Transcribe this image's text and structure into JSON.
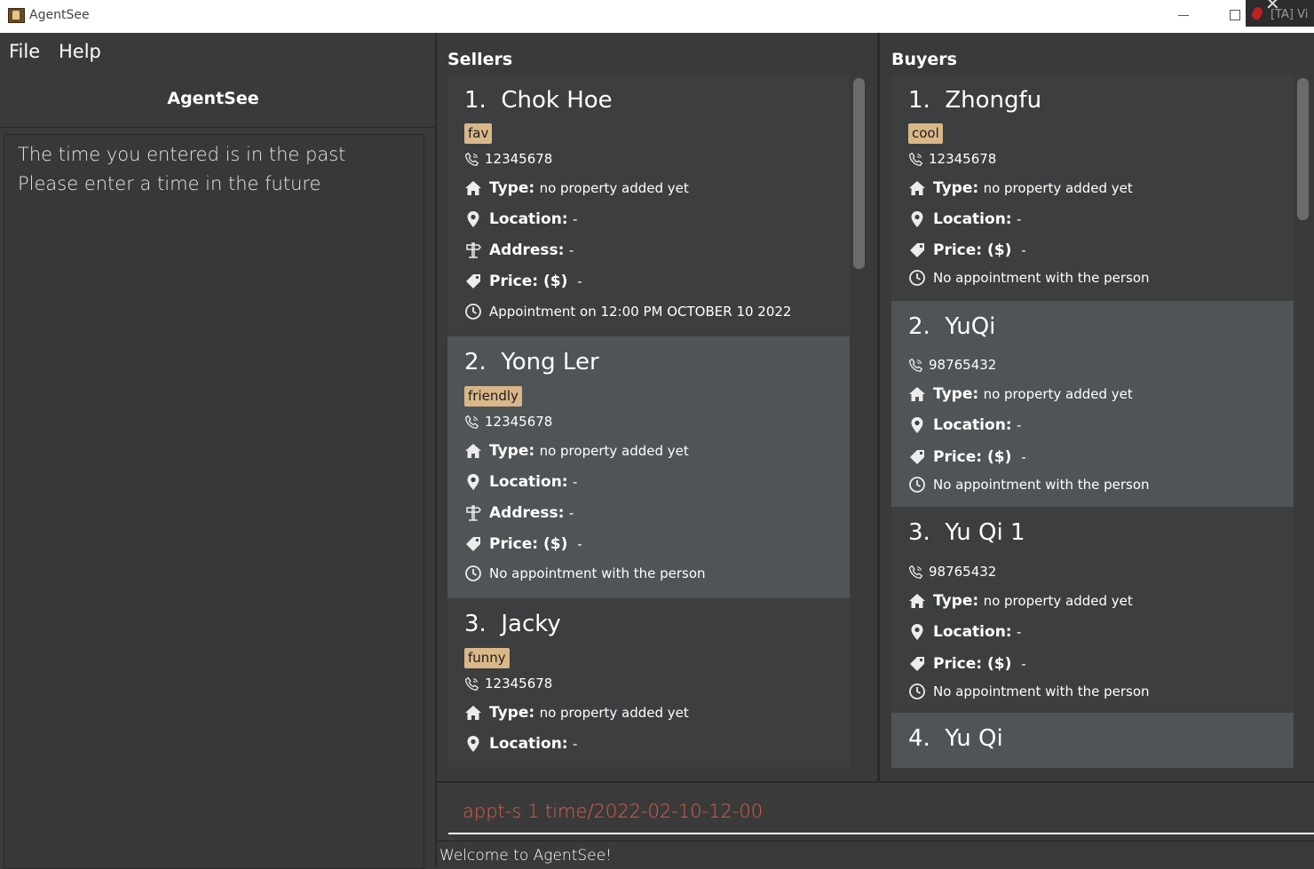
{
  "window": {
    "title": "AgentSee",
    "overlay_text": "[TA] Vi"
  },
  "menu": {
    "file": "File",
    "help": "Help"
  },
  "app_heading": "AgentSee",
  "result": {
    "line1": "The time you entered is in the past",
    "line2": "Please enter a time in the future"
  },
  "sellers": {
    "title": "Sellers",
    "cards": [
      {
        "index": "1.",
        "name": "Chok Hoe",
        "tag": "fav",
        "phone": "12345678",
        "type_label": "Type:",
        "type_value": "no property added yet",
        "location_label": "Location:",
        "location_value": "-",
        "address_label": "Address:",
        "address_value": "-",
        "price_label": "Price: ($)",
        "price_value": "-",
        "appointment": "Appointment on 12:00 PM OCTOBER 10 2022"
      },
      {
        "index": "2.",
        "name": "Yong Ler",
        "tag": "friendly",
        "phone": "12345678",
        "type_label": "Type:",
        "type_value": "no property added yet",
        "location_label": "Location:",
        "location_value": "-",
        "address_label": "Address:",
        "address_value": "-",
        "price_label": "Price: ($)",
        "price_value": "-",
        "appointment": "No appointment with the person"
      },
      {
        "index": "3.",
        "name": "Jacky",
        "tag": "funny",
        "phone": "12345678",
        "type_label": "Type:",
        "type_value": "no property added yet",
        "location_label": "Location:",
        "location_value": "-"
      }
    ]
  },
  "buyers": {
    "title": "Buyers",
    "cards": [
      {
        "index": "1.",
        "name": "Zhongfu",
        "tag": "cool",
        "phone": "12345678",
        "type_label": "Type:",
        "type_value": "no property added yet",
        "location_label": "Location:",
        "location_value": "-",
        "price_label": "Price: ($)",
        "price_value": "-",
        "appointment": "No appointment with the person"
      },
      {
        "index": "2.",
        "name": "YuQi",
        "phone": "98765432",
        "type_label": "Type:",
        "type_value": "no property added yet",
        "location_label": "Location:",
        "location_value": "-",
        "price_label": "Price: ($)",
        "price_value": "-",
        "appointment": "No appointment with the person"
      },
      {
        "index": "3.",
        "name": "Yu Qi 1",
        "phone": "98765432",
        "type_label": "Type:",
        "type_value": "no property added yet",
        "location_label": "Location:",
        "location_value": "-",
        "price_label": "Price: ($)",
        "price_value": "-",
        "appointment": "No appointment with the person"
      },
      {
        "index": "4.",
        "name": "Yu Qi"
      }
    ]
  },
  "command": {
    "value": "appt-s 1 time/2022-02-10-12-00"
  },
  "status": {
    "text": "Welcome to AgentSee!"
  },
  "colors": {
    "background": "#3a3a3a",
    "card": "#3c3e3f",
    "card_alt": "#4f5457",
    "tag": "#d9b789",
    "command_text": "#d75f4b"
  },
  "icons": {
    "phone": "phone-icon",
    "type": "house-icon",
    "location": "location-pin-icon",
    "address": "signpost-icon",
    "price": "price-tag-icon",
    "appointment": "clock-icon"
  }
}
